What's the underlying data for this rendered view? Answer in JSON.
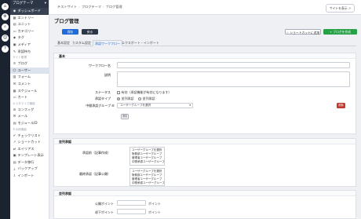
{
  "app": {
    "site_menu": "ブログテーマ",
    "dashboard": "ダッシュボード"
  },
  "rail": {
    "icons": [
      "home-icon",
      "gear-icon",
      "search-icon",
      "user-icon",
      "help-icon"
    ]
  },
  "sidebar": {
    "items_top": [
      {
        "icon": "▦",
        "label": "エントリー"
      },
      {
        "icon": "▤",
        "label": "ユニット"
      },
      {
        "icon": "▭",
        "label": "カテゴリー"
      },
      {
        "icon": "◆",
        "label": "タグ"
      },
      {
        "icon": "▣",
        "label": "メディア"
      },
      {
        "icon": "✎",
        "label": "承認待ち"
      }
    ],
    "section_site": "サイト管理",
    "items_site": [
      {
        "icon": "≡",
        "label": "ブログ"
      },
      {
        "icon": "☺",
        "label": "ユーザー"
      },
      {
        "icon": "▥",
        "label": "フォーム"
      },
      {
        "icon": "✉",
        "label": "コメント"
      },
      {
        "icon": "▦",
        "label": "スケジュール"
      },
      {
        "icon": "▭",
        "label": "カート"
      }
    ],
    "section_custom": "カスタマイズ機能",
    "items_custom": [
      {
        "icon": "⚙",
        "label": "コンフィグ"
      },
      {
        "icon": "✉",
        "label": "メール"
      },
      {
        "icon": "▤",
        "label": "モジュールID"
      }
    ],
    "section_other": "その他機能",
    "items_other": [
      {
        "icon": "✔",
        "label": "チェックリスト"
      },
      {
        "icon": "↗",
        "label": "ショートカット"
      },
      {
        "icon": "⇄",
        "label": "エイリアス"
      },
      {
        "icon": "▣",
        "label": "テンプレート表示"
      },
      {
        "icon": "▤",
        "label": "データ移行"
      },
      {
        "icon": "⤓",
        "label": "バックアップ"
      },
      {
        "icon": "⇩",
        "label": "インポート"
      }
    ]
  },
  "topbar": {
    "crumbs": [
      "テストサイト",
      "ブログテーマ",
      "ブログ管理"
    ],
    "view_site": "サイトを表示"
  },
  "main": {
    "title": "ブログ管理",
    "btn_new": "保存",
    "btn_list": "戻る",
    "btn_shortcut": "ショートカットに追加",
    "btn_new_workflow": "+ ブログを作成",
    "tabs": [
      "基本設定",
      "カスタム設定",
      "承認ワークフロー",
      "エクスポート・インポート"
    ],
    "active_tab": 2
  },
  "basic": {
    "header": "基本",
    "name_label": "ワークフロー名",
    "desc_label": "説明",
    "status_label": "ステータス",
    "status_option": "有効（承認機能が有効になります）",
    "type_label": "承認タイプ",
    "type_options": [
      "並列承認",
      "並列承認"
    ],
    "group_label": "中間承認グループ",
    "group_select": "ユーザーグループを選択",
    "delete_btn": "削除",
    "add_btn": "追加"
  },
  "approvers": {
    "header": "並列承認",
    "first_label": "承認前（記事作成）",
    "first_options": [
      "ユーザーグループを選択",
      "財務部ユーザーグループ",
      "管理者ユーザーグループ",
      "中間承認ユーザーグループ"
    ],
    "last_label": "最終承認（記事公開）",
    "last_options": [
      "ユーザーグループを選択",
      "財務部ユーザーグループ",
      "管理者ユーザーグループ",
      "中間承認ユーザーグループ"
    ]
  },
  "points": {
    "header": "並列承認",
    "pub_label": "公開ポイント",
    "pub_unit": "ポイント",
    "down_label": "却下ポイント",
    "down_unit": "ポイント"
  }
}
